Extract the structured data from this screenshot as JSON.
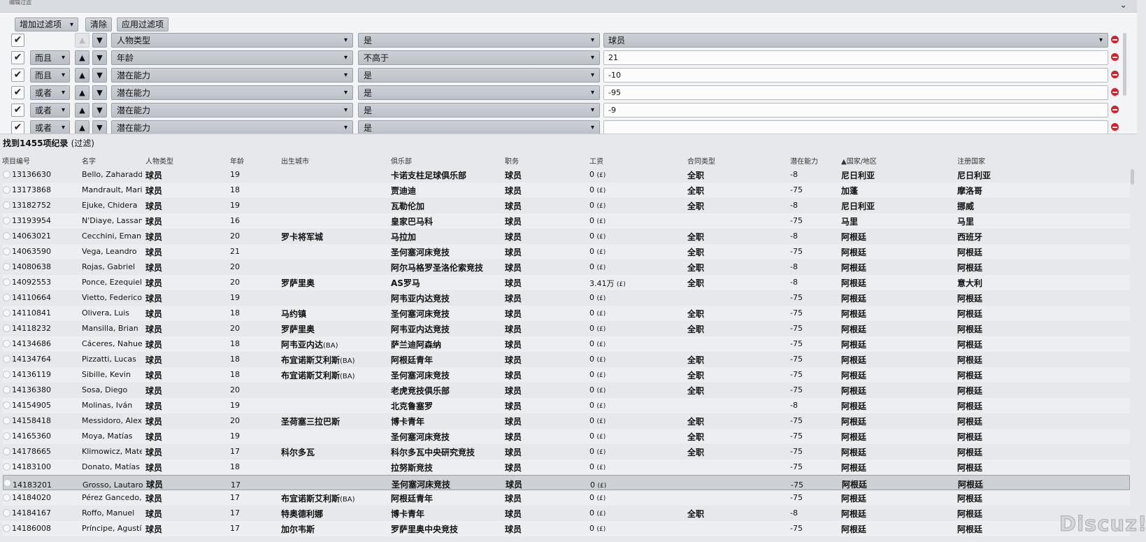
{
  "panel": {
    "title": "编辑过滤",
    "toolbar": {
      "add_filter_label": "增加过滤项",
      "clear_label": "清除",
      "apply_label": "应用过滤项"
    },
    "filters": [
      {
        "checked": true,
        "logic": "",
        "field": "人物类型",
        "operator": "是",
        "value": "球员",
        "value_is_select": true
      },
      {
        "checked": true,
        "logic": "而且",
        "field": "年龄",
        "operator": "不高于",
        "value": "21"
      },
      {
        "checked": true,
        "logic": "而且",
        "field": "潜在能力",
        "operator": "是",
        "value": "-10"
      },
      {
        "checked": true,
        "logic": "或者",
        "field": "潜在能力",
        "operator": "是",
        "value": "-95"
      },
      {
        "checked": true,
        "logic": "或者",
        "field": "潜在能力",
        "operator": "是",
        "value": "-9"
      },
      {
        "checked": true,
        "logic": "或者",
        "field": "潜在能力",
        "operator": "是",
        "value": ""
      }
    ]
  },
  "results": {
    "count_prefix": "找到",
    "count": "1455",
    "count_suffix": "项纪录",
    "count_note": "(过滤)"
  },
  "columns": [
    "项目编号",
    "名字",
    "人物类型",
    "年龄",
    "出生城市",
    "俱乐部",
    "职务",
    "工资",
    "合同类型",
    "潜在能力",
    "▲国家/地区",
    "注册国家"
  ],
  "rows": [
    {
      "id": "13136630",
      "name": "Bello, Zaharadde...",
      "type": "球员",
      "age": "19",
      "city": "",
      "club": "卡诺支柱足球俱乐部",
      "role": "球员",
      "wage": "0",
      "wage_unit": "(£)",
      "contract": "全职",
      "pa": "-8",
      "nation": "尼日利亚",
      "reg": "尼日利亚"
    },
    {
      "id": "13173868",
      "name": "Mandrault, Mario",
      "type": "球员",
      "age": "18",
      "city": "",
      "club": "贾迪迪",
      "role": "球员",
      "wage": "0",
      "wage_unit": "(£)",
      "contract": "全职",
      "pa": "-75",
      "nation": "加蓬",
      "reg": "摩洛哥"
    },
    {
      "id": "13182752",
      "name": "Ejuke, Chidera",
      "type": "球员",
      "age": "19",
      "city": "",
      "club": "瓦勒伦加",
      "role": "球员",
      "wage": "0",
      "wage_unit": "(£)",
      "contract": "全职",
      "pa": "-8",
      "nation": "尼日利亚",
      "reg": "挪威"
    },
    {
      "id": "13193954",
      "name": "N'Diaye, Lassana",
      "type": "球员",
      "age": "16",
      "city": "",
      "club": "皇家巴马科",
      "role": "球员",
      "wage": "0",
      "wage_unit": "(£)",
      "contract": "",
      "pa": "-75",
      "nation": "马里",
      "reg": "马里"
    },
    {
      "id": "14063021",
      "name": "Cecchini, Emanuel",
      "type": "球员",
      "age": "20",
      "city": "罗卡将军城",
      "club": "马拉加",
      "role": "球员",
      "wage": "0",
      "wage_unit": "(£)",
      "contract": "全职",
      "pa": "-8",
      "nation": "阿根廷",
      "reg": "西班牙"
    },
    {
      "id": "14063590",
      "name": "Vega, Leandro",
      "type": "球员",
      "age": "21",
      "city": "",
      "club": "圣何塞河床竞技",
      "role": "球员",
      "wage": "0",
      "wage_unit": "(£)",
      "contract": "全职",
      "pa": "-75",
      "nation": "阿根廷",
      "reg": "阿根廷"
    },
    {
      "id": "14080638",
      "name": "Rojas, Gabriel",
      "type": "球员",
      "age": "20",
      "city": "",
      "club": "阿尔马格罗圣洛伦索竞技",
      "role": "球员",
      "wage": "0",
      "wage_unit": "(£)",
      "contract": "全职",
      "pa": "-8",
      "nation": "阿根廷",
      "reg": "阿根廷"
    },
    {
      "id": "14092553",
      "name": "Ponce, Ezequiel",
      "type": "球员",
      "age": "20",
      "city": "罗萨里奥",
      "club": "AS罗马",
      "role": "球员",
      "wage": "3.41万",
      "wage_unit": "(£)",
      "contract": "全职",
      "pa": "-8",
      "nation": "阿根廷",
      "reg": "意大利"
    },
    {
      "id": "14110664",
      "name": "Vietto, Federico",
      "type": "球员",
      "age": "19",
      "city": "",
      "club": "阿韦亚内达竞技",
      "role": "球员",
      "wage": "0",
      "wage_unit": "(£)",
      "contract": "",
      "pa": "-75",
      "nation": "阿根廷",
      "reg": "阿根廷"
    },
    {
      "id": "14110841",
      "name": "Olivera, Luis",
      "type": "球员",
      "age": "18",
      "city": "马约镇",
      "club": "圣何塞河床竞技",
      "role": "球员",
      "wage": "0",
      "wage_unit": "(£)",
      "contract": "全职",
      "pa": "-75",
      "nation": "阿根廷",
      "reg": "阿根廷"
    },
    {
      "id": "14118232",
      "name": "Mansilla, Brian",
      "type": "球员",
      "age": "20",
      "city": "罗萨里奥",
      "club": "阿韦亚内达竞技",
      "role": "球员",
      "wage": "0",
      "wage_unit": "(£)",
      "contract": "全职",
      "pa": "-75",
      "nation": "阿根廷",
      "reg": "阿根廷"
    },
    {
      "id": "14134686",
      "name": "Cáceres, Nahuel",
      "type": "球员",
      "age": "18",
      "city": "阿韦亚内达",
      "city_suffix": "(BA)",
      "club": "萨兰迪阿森纳",
      "role": "球员",
      "wage": "0",
      "wage_unit": "(£)",
      "contract": "",
      "pa": "-75",
      "nation": "阿根廷",
      "reg": "阿根廷"
    },
    {
      "id": "14134764",
      "name": "Pizzatti, Lucas",
      "type": "球员",
      "age": "18",
      "city": "布宜诺斯艾利斯",
      "city_suffix": "(BA)",
      "club": "阿根廷青年",
      "role": "球员",
      "wage": "0",
      "wage_unit": "(£)",
      "contract": "全职",
      "pa": "-75",
      "nation": "阿根廷",
      "reg": "阿根廷"
    },
    {
      "id": "14136119",
      "name": "Sibille, Kevin",
      "type": "球员",
      "age": "18",
      "city": "布宜诺斯艾利斯",
      "city_suffix": "(BA)",
      "club": "圣何塞河床竞技",
      "role": "球员",
      "wage": "0",
      "wage_unit": "(£)",
      "contract": "全职",
      "pa": "-75",
      "nation": "阿根廷",
      "reg": "阿根廷"
    },
    {
      "id": "14136380",
      "name": "Sosa, Diego",
      "type": "球员",
      "age": "20",
      "city": "",
      "club": "老虎竞技俱乐部",
      "role": "球员",
      "wage": "0",
      "wage_unit": "(£)",
      "contract": "全职",
      "pa": "-75",
      "nation": "阿根廷",
      "reg": "阿根廷"
    },
    {
      "id": "14154905",
      "name": "Molinas, Iván",
      "type": "球员",
      "age": "19",
      "city": "",
      "club": "北克鲁塞罗",
      "role": "球员",
      "wage": "0",
      "wage_unit": "(£)",
      "contract": "",
      "pa": "-8",
      "nation": "阿根廷",
      "reg": "阿根廷"
    },
    {
      "id": "14158418",
      "name": "Messidoro, Alexis",
      "type": "球员",
      "age": "20",
      "city": "圣荷塞三拉巴斯",
      "club": "博卡青年",
      "role": "球员",
      "wage": "0",
      "wage_unit": "(£)",
      "contract": "全职",
      "pa": "-75",
      "nation": "阿根廷",
      "reg": "阿根廷"
    },
    {
      "id": "14165360",
      "name": "Moya, Matías",
      "type": "球员",
      "age": "19",
      "city": "",
      "club": "圣何塞河床竞技",
      "role": "球员",
      "wage": "0",
      "wage_unit": "(£)",
      "contract": "全职",
      "pa": "-75",
      "nation": "阿根廷",
      "reg": "阿根廷"
    },
    {
      "id": "14178665",
      "name": "Klimowicz, Mateo",
      "type": "球员",
      "age": "17",
      "city": "科尔多瓦",
      "club": "科尔多瓦中央研究竞技",
      "role": "球员",
      "wage": "0",
      "wage_unit": "(£)",
      "contract": "全职",
      "pa": "-75",
      "nation": "阿根廷",
      "reg": "阿根廷"
    },
    {
      "id": "14183100",
      "name": "Donato, Matías",
      "type": "球员",
      "age": "18",
      "city": "",
      "club": "拉努斯竞技",
      "role": "球员",
      "wage": "0",
      "wage_unit": "(£)",
      "contract": "",
      "pa": "-75",
      "nation": "阿根廷",
      "reg": "阿根廷"
    },
    {
      "id": "14183201",
      "name": "Grosso, Lautaro",
      "type": "球员",
      "age": "17",
      "city": "",
      "club": "圣何塞河床竞技",
      "role": "球员",
      "wage": "0",
      "wage_unit": "(£)",
      "contract": "",
      "pa": "-75",
      "nation": "阿根廷",
      "reg": "阿根廷",
      "selected": true
    },
    {
      "id": "14184020",
      "name": "Pérez Gancedo,...",
      "type": "球员",
      "age": "17",
      "city": "布宜诺斯艾利斯",
      "city_suffix": "(BA)",
      "club": "阿根廷青年",
      "role": "球员",
      "wage": "0",
      "wage_unit": "(£)",
      "contract": "",
      "pa": "-75",
      "nation": "阿根廷",
      "reg": "阿根廷"
    },
    {
      "id": "14184167",
      "name": "Roffo, Manuel",
      "type": "球员",
      "age": "17",
      "city": "特奥德利娜",
      "club": "博卡青年",
      "role": "球员",
      "wage": "0",
      "wage_unit": "(£)",
      "contract": "全职",
      "pa": "-8",
      "nation": "阿根廷",
      "reg": "阿根廷"
    },
    {
      "id": "14186008",
      "name": "Príncipe, Agustín",
      "type": "球员",
      "age": "17",
      "city": "加尔韦斯",
      "club": "罗萨里奥中央竞技",
      "role": "球员",
      "wage": "0",
      "wage_unit": "(£)",
      "contract": "",
      "pa": "-75",
      "nation": "阿根廷",
      "reg": "阿根廷"
    }
  ],
  "watermark": "Discuz!"
}
